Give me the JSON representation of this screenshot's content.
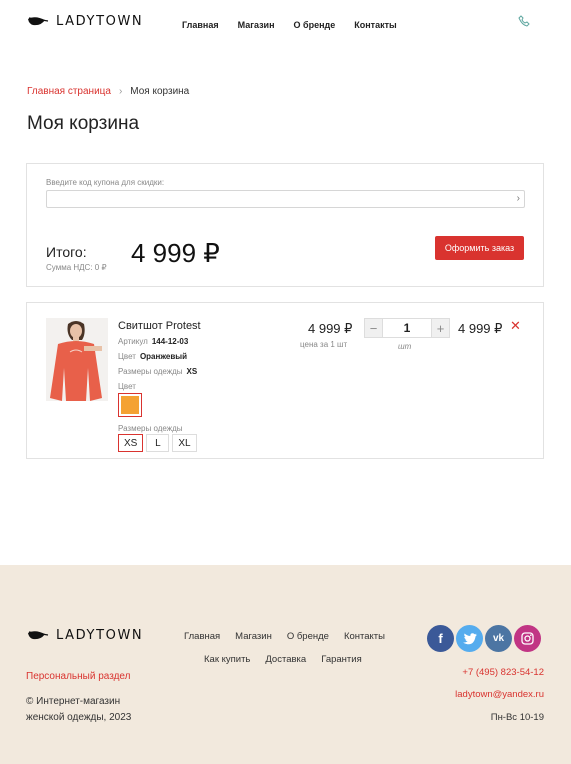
{
  "header": {
    "logo_text": "LADYTOWN",
    "nav": [
      "Главная",
      "Магазин",
      "О бренде",
      "Контакты"
    ],
    "phone_icon": "phone-icon"
  },
  "breadcrumb": {
    "home": "Главная страница",
    "separator": "›",
    "current": "Моя корзина"
  },
  "page_title": "Моя корзина",
  "coupon": {
    "label": "Введите код купона для скидки:",
    "value": "",
    "go": "›"
  },
  "summary": {
    "total_label": "Итого:",
    "vat_label": "Сумма НДС: 0 ₽",
    "total_value": "4 999 ₽",
    "order_button": "Оформить заказ"
  },
  "item": {
    "name": "Свитшот Protest",
    "sku_label": "Артикул",
    "sku": "144-12-03",
    "color_label": "Цвет",
    "color": "Оранжевый",
    "size_label": "Размеры одежды",
    "size": "XS",
    "color_title": "Цвет",
    "color_swatch": "#f4a233",
    "size_title": "Размеры одежды",
    "sizes": [
      "XS",
      "L",
      "XL"
    ],
    "selected_size": "XS",
    "unit_price": "4 999 ₽",
    "unit_caption": "цена за 1 шт",
    "qty_minus": "−",
    "quantity": "1",
    "qty_plus": "+",
    "qty_caption": "шт",
    "line_total": "4 999 ₽",
    "remove": "✕"
  },
  "footer": {
    "logo_text": "LADYTOWN",
    "nav_row1": [
      "Главная",
      "Магазин",
      "О бренде",
      "Контакты"
    ],
    "nav_row2": [
      "Как купить",
      "Доставка",
      "Гарантия"
    ],
    "personal": "Персональный раздел",
    "copyright_line1": "© Интернет-магазин",
    "copyright_line2": "женской одежды, 2023",
    "social": {
      "fb": "f",
      "vk": "vk"
    },
    "phone": "+7 (495) 823-54-12",
    "email": "ladytown@yandex.ru",
    "hours": "Пн-Вс 10-19"
  },
  "colors": {
    "accent": "#d9332f",
    "footer_bg": "#f2e9dd"
  }
}
